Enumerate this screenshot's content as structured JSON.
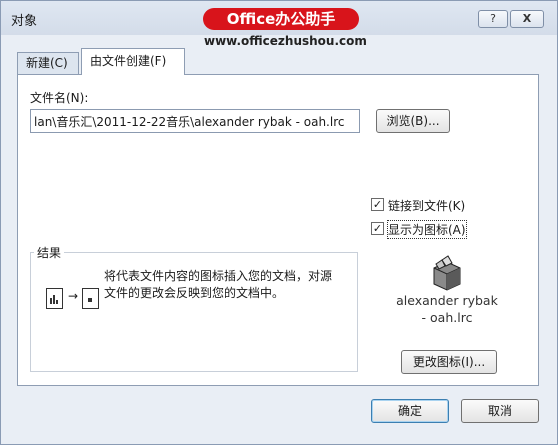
{
  "window": {
    "title": "对象",
    "help_label": "?",
    "close_label": "X"
  },
  "watermark": {
    "brand": "Office办公助手",
    "url": "www.officezhushou.com"
  },
  "tabs": [
    {
      "label": "新建(C)",
      "selected": false
    },
    {
      "label": "由文件创建(F)",
      "selected": true
    }
  ],
  "file": {
    "label": "文件名(N):",
    "value": "lan\\音乐汇\\2011-12-22音乐\\alexander rybak - oah.lrc",
    "browse_label": "浏览(B)..."
  },
  "options": {
    "link": {
      "label": "链接到文件(K)",
      "checked": true
    },
    "icon": {
      "label": "显示为图标(A)",
      "checked": true
    }
  },
  "results": {
    "title": "结果",
    "line1": "将代表文件内容的图标插入您的文档，对源",
    "line2": "文件的更改会反映到您的文档中。"
  },
  "icon_preview": {
    "icon": "package-icon",
    "line1": "alexander rybak",
    "line2": "- oah.lrc",
    "change_label": "更改图标(I)..."
  },
  "footer": {
    "ok_label": "确定",
    "cancel_label": "取消"
  }
}
